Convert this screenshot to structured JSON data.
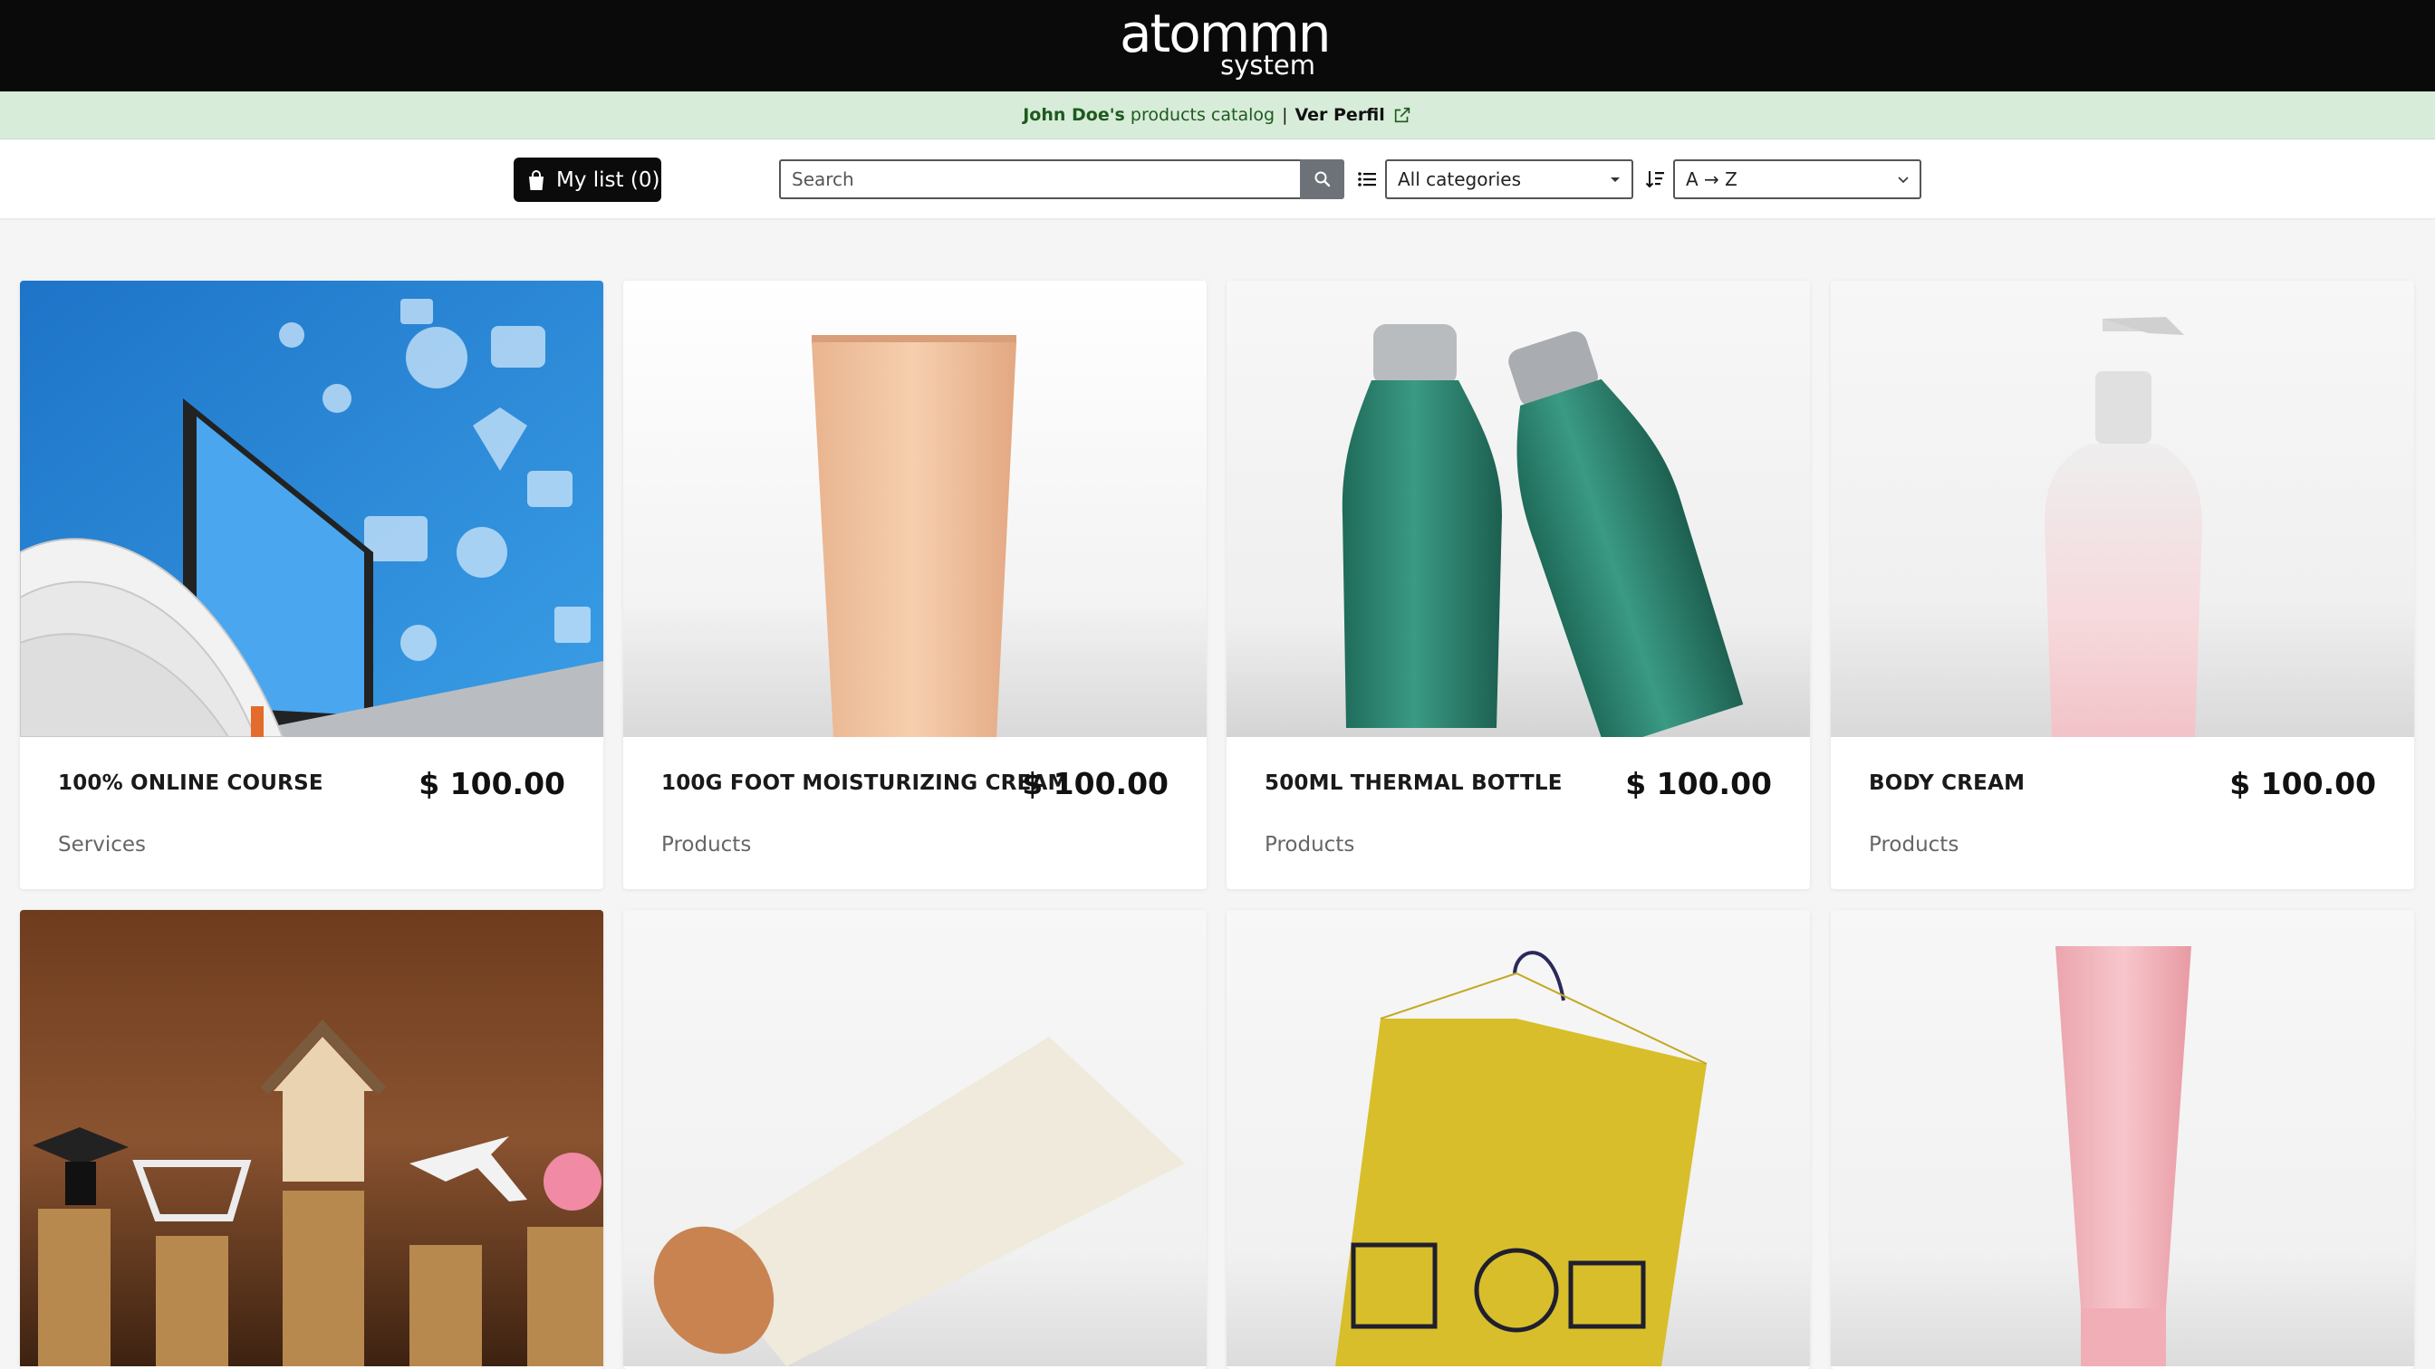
{
  "brand": {
    "logo_main": "atommn",
    "logo_sub": "system"
  },
  "info_bar": {
    "owner": "John Doe's",
    "catalog_text": "products catalog",
    "separator": "|",
    "profile_link": "Ver Perfil"
  },
  "toolbar": {
    "my_list_label": "My list (0)",
    "search_placeholder": "Search",
    "category_selected": "All categories",
    "sort_selected": "A → Z"
  },
  "products": [
    {
      "name": "100% ONLINE COURSE",
      "price": "$ 100.00",
      "category": "Services"
    },
    {
      "name": "100G FOOT MOISTURIZING CREAM",
      "price": "$ 100.00",
      "category": "Products"
    },
    {
      "name": "500ML THERMAL BOTTLE",
      "price": "$ 100.00",
      "category": "Products"
    },
    {
      "name": "BODY CREAM",
      "price": "$ 100.00",
      "category": "Products"
    }
  ],
  "colors": {
    "header_bg": "#0a0a0a",
    "info_bar_bg": "#d7ecd9",
    "info_text": "#1e5a1e",
    "search_button": "#6c7278"
  }
}
